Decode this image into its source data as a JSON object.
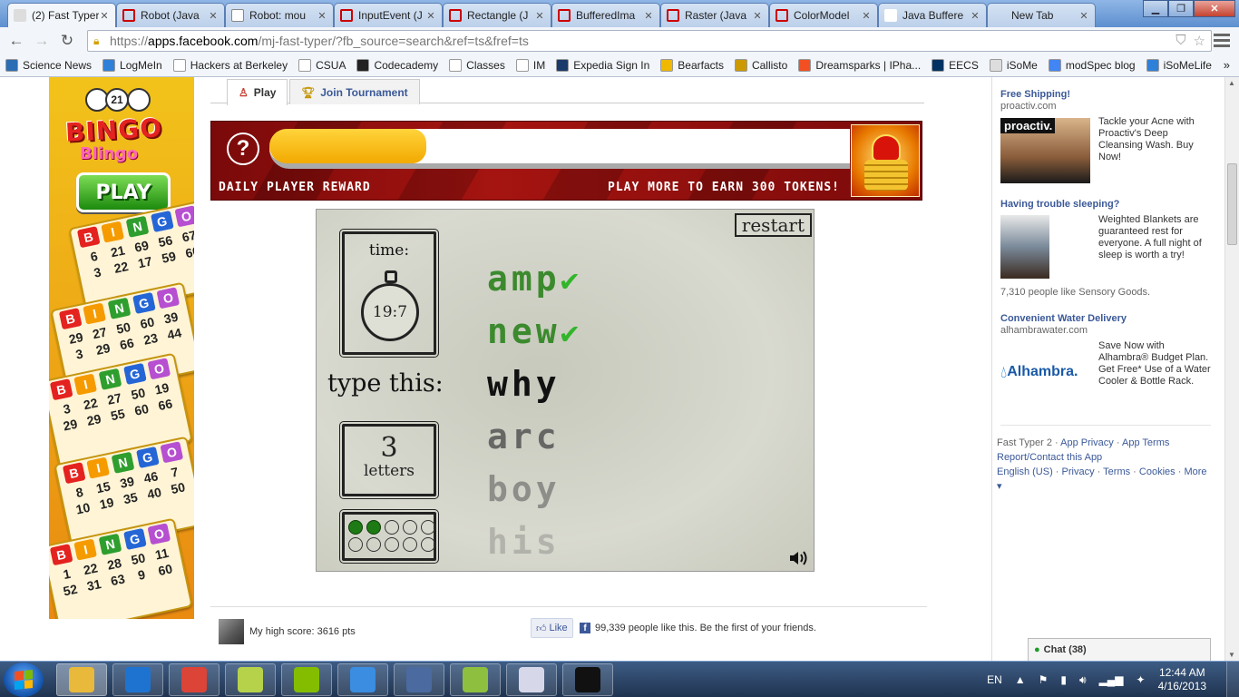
{
  "browser": {
    "tabs": [
      {
        "title": "(2) Fast Typer",
        "icon": "facebook-app-icon",
        "active": true
      },
      {
        "title": "Robot (Java",
        "icon": "oracle-icon"
      },
      {
        "title": "Robot: mou",
        "icon": "page-icon"
      },
      {
        "title": "InputEvent (J",
        "icon": "oracle-icon"
      },
      {
        "title": "Rectangle (J",
        "icon": "oracle-icon"
      },
      {
        "title": "BufferedIma",
        "icon": "oracle-icon"
      },
      {
        "title": "Raster (Java",
        "icon": "oracle-icon"
      },
      {
        "title": "ColorModel",
        "icon": "oracle-icon"
      },
      {
        "title": "Java Buffere",
        "icon": "java-icon"
      },
      {
        "title": "New Tab",
        "icon": "none"
      }
    ],
    "url": {
      "scheme": "https://",
      "host": "apps.facebook.com",
      "rest": "/mj-fast-typer/?fb_source=search&ref=ts&fref=ts"
    },
    "bookmarks": [
      {
        "label": "Science News",
        "icon": "science-news-icon",
        "color": "#2a6db5"
      },
      {
        "label": "LogMeIn",
        "icon": "logmein-icon",
        "color": "#2f80d8"
      },
      {
        "label": "Hackers at Berkeley",
        "icon": "folder-page-icon",
        "color": "#ffffff"
      },
      {
        "label": "CSUA",
        "icon": "page-icon",
        "color": "#ffffff"
      },
      {
        "label": "Codecademy",
        "icon": "codecademy-icon",
        "color": "#222222"
      },
      {
        "label": "Classes",
        "icon": "page-icon",
        "color": "#ffffff"
      },
      {
        "label": "IM",
        "icon": "page-icon",
        "color": "#ffffff"
      },
      {
        "label": "Expedia Sign In",
        "icon": "expedia-icon",
        "color": "#1a3a6b"
      },
      {
        "label": "Bearfacts",
        "icon": "bearfacts-icon",
        "color": "#f1b800"
      },
      {
        "label": "Callisto",
        "icon": "callisto-icon",
        "color": "#cc9900"
      },
      {
        "label": "Dreamsparks | IPha...",
        "icon": "windows-icon",
        "color": "#f25022"
      },
      {
        "label": "EECS",
        "icon": "cal-icon",
        "color": "#003262"
      },
      {
        "label": "iSoMe",
        "icon": "speech-bubble-icon",
        "color": "#dddddd"
      },
      {
        "label": "modSpec blog",
        "icon": "google-icon",
        "color": "#4285f4"
      },
      {
        "label": "iSoMeLife",
        "icon": "isomelife-icon",
        "color": "#2f80d8"
      }
    ]
  },
  "bingo_ad": {
    "logo_top": "BINGO",
    "logo_bottom": "Blingo",
    "ball_number": "21",
    "play_label": "PLAY",
    "card_letters": [
      "B",
      "I",
      "N",
      "G",
      "O"
    ],
    "card_colors": [
      "#e4221f",
      "#f59b00",
      "#2e9e2e",
      "#2566d6",
      "#b64fd0"
    ],
    "cards": [
      {
        "nums": [
          "6",
          "21",
          "69",
          "56",
          "67",
          "3",
          "22",
          "17",
          "59",
          "60"
        ]
      },
      {
        "nums": [
          "29",
          "27",
          "50",
          "60",
          "39",
          "3",
          "29",
          "66",
          "23",
          "44"
        ]
      },
      {
        "nums": [
          "3",
          "22",
          "27",
          "50",
          "19",
          "29",
          "29",
          "55",
          "60",
          "66"
        ]
      },
      {
        "nums": [
          "8",
          "15",
          "39",
          "46",
          "7",
          "10",
          "19",
          "35",
          "40",
          "50"
        ]
      },
      {
        "nums": [
          "1",
          "22",
          "28",
          "50",
          "11",
          "52",
          "31",
          "63",
          "9",
          "60"
        ]
      }
    ]
  },
  "app": {
    "tabs": [
      {
        "label": "Play",
        "icon": "person-icon"
      },
      {
        "label": "Join Tournament",
        "icon": "trophy-icon"
      }
    ],
    "reward": {
      "left_label": "DAILY PLAYER REWARD",
      "right_label": "PLAY MORE TO EARN 300 TOKENS!",
      "progress": 0.27,
      "help": "?"
    },
    "game": {
      "restart_label": "restart",
      "time_label": "time:",
      "time_value": "19:7",
      "type_this_label": "type this:",
      "letters_count": "3",
      "letters_label": "letters",
      "dots_filled": 2,
      "dots_total": 10,
      "words_done": [
        "amp",
        "new"
      ],
      "word_current": "why",
      "words_upcoming": [
        "arc",
        "boy",
        "his"
      ]
    },
    "score_text": "My high score: 3616 pts",
    "like_label": "Like",
    "like_count_text": "99,339 people like this. Be the first of your friends."
  },
  "right_ads": [
    {
      "title": "Free Shipping!",
      "domain": "proactiv.com",
      "image_label": "proactiv.",
      "body": "Tackle your Acne with Proactiv's Deep Cleansing Wash. Buy Now!",
      "social": ""
    },
    {
      "title": "Having trouble sleeping?",
      "domain": "",
      "image_label": "",
      "body": "Weighted Blankets are guaranteed rest for everyone. A full night of sleep is worth a try!",
      "social": "7,310 people like Sensory Goods."
    },
    {
      "title": "Convenient Water Delivery",
      "domain": "alhambrawater.com",
      "image_label": "Alhambra.",
      "body": "Save Now with Alhambra® Budget Plan. Get Free* Use of a Water Cooler & Bottle Rack.",
      "social": ""
    }
  ],
  "footer": {
    "line1": [
      "Fast Typer 2",
      "App Privacy",
      "App Terms"
    ],
    "line2": [
      "Report/Contact this App"
    ],
    "line3": [
      "English (US)",
      "Privacy",
      "Terms",
      "Cookies",
      "More ▾"
    ]
  },
  "chat": {
    "label": "Chat (38)"
  },
  "taskbar": {
    "items": [
      {
        "icon": "windows-explorer-icon",
        "color": "#e8b93a"
      },
      {
        "icon": "internet-explorer-icon",
        "color": "#1e73d1"
      },
      {
        "icon": "chrome-icon",
        "color": "#db4437"
      },
      {
        "icon": "sticky-notes-icon",
        "color": "#b6d24b"
      },
      {
        "icon": "spotify-icon",
        "color": "#84bd00"
      },
      {
        "icon": "itunes-icon",
        "color": "#3a8de0"
      },
      {
        "icon": "network-manager-icon",
        "color": "#4a6aa0"
      },
      {
        "icon": "notepad-plus-icon",
        "color": "#8fbf3f"
      },
      {
        "icon": "paint-icon",
        "color": "#d7d7ea"
      },
      {
        "icon": "command-prompt-icon",
        "color": "#111111"
      }
    ],
    "language": "EN",
    "time": "12:44 AM",
    "date": "4/16/2013"
  }
}
